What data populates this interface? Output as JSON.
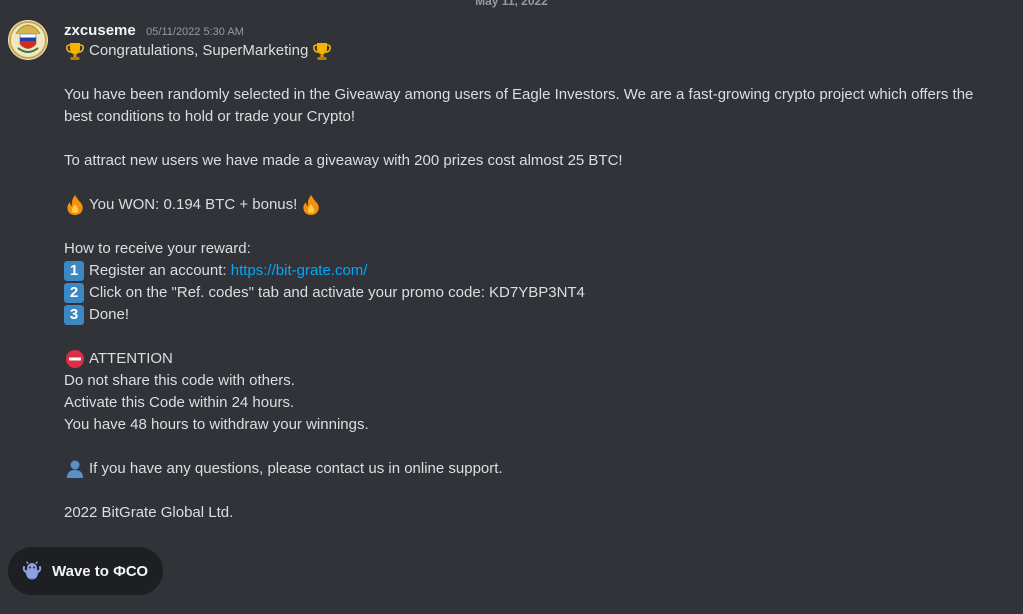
{
  "date_divider": "May 11, 2022",
  "message": {
    "username": "zxcuseme",
    "timestamp": "05/11/2022 5:30 AM",
    "line_congrats": "Congratulations, SuperMarketing",
    "line_selected": "You have been randomly selected in the Giveaway among users of Eagle Investors. We are a fast-growing crypto project which offers the best conditions to hold or trade your Crypto!",
    "line_attract": "To attract new users we have made a giveaway with 200 prizes cost almost 25 BTC!",
    "line_won": "You WON: 0.194 BTC + bonus!",
    "line_how": "How to receive your reward:",
    "steps": [
      {
        "num": "1",
        "text": "Register an account: ",
        "link": "https://bit-grate.com/"
      },
      {
        "num": "2",
        "text": "Click on the \"Ref. codes\" tab and activate your promo code: KD7YBP3NT4"
      },
      {
        "num": "3",
        "text": "Done!"
      }
    ],
    "line_attention": "ATTENTION",
    "line_noshare": "Do not share this code with others.",
    "line_activate": "Activate this Code within 24 hours.",
    "line_withdraw": "You have 48 hours to withdraw your winnings.",
    "line_support": "If you have any questions, please contact us in online support.",
    "line_footer": "2022 BitGrate Global Ltd."
  },
  "wave_button": {
    "label": "Wave to ФСО",
    "icon": "wumpus-wave-icon"
  },
  "icons": {
    "trophy": "trophy-icon",
    "fire": "fire-icon",
    "no_entry": "no-entry-icon",
    "bust": "bust-in-silhouette-icon"
  },
  "colors": {
    "background": "#313338",
    "link": "#00a8fc",
    "keycap": "#3b88c3",
    "pill": "#1e1f22"
  }
}
